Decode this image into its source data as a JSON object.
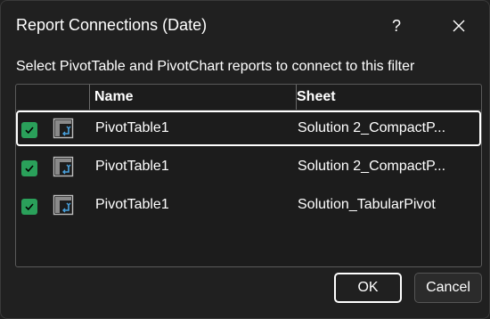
{
  "dialog": {
    "title": "Report Connections (Date)",
    "help_label": "?",
    "instruction": "Select PivotTable and PivotChart reports to connect to this filter"
  },
  "list": {
    "columns": {
      "name": "Name",
      "sheet": "Sheet"
    },
    "rows": [
      {
        "checked": true,
        "name": "PivotTable1",
        "sheet": "Solution 2_CompactP..."
      },
      {
        "checked": true,
        "name": "PivotTable1",
        "sheet": "Solution 2_CompactP..."
      },
      {
        "checked": true,
        "name": "PivotTable1",
        "sheet": "Solution_TabularPivot"
      }
    ]
  },
  "buttons": {
    "ok": "OK",
    "cancel": "Cancel"
  },
  "colors": {
    "checkbox": "#2aa05a",
    "background": "#202020",
    "focus_border": "#ffffff"
  },
  "icons": {
    "help": "question-mark-icon",
    "close": "close-icon",
    "row": "pivottable-icon",
    "check": "checkmark-icon"
  }
}
